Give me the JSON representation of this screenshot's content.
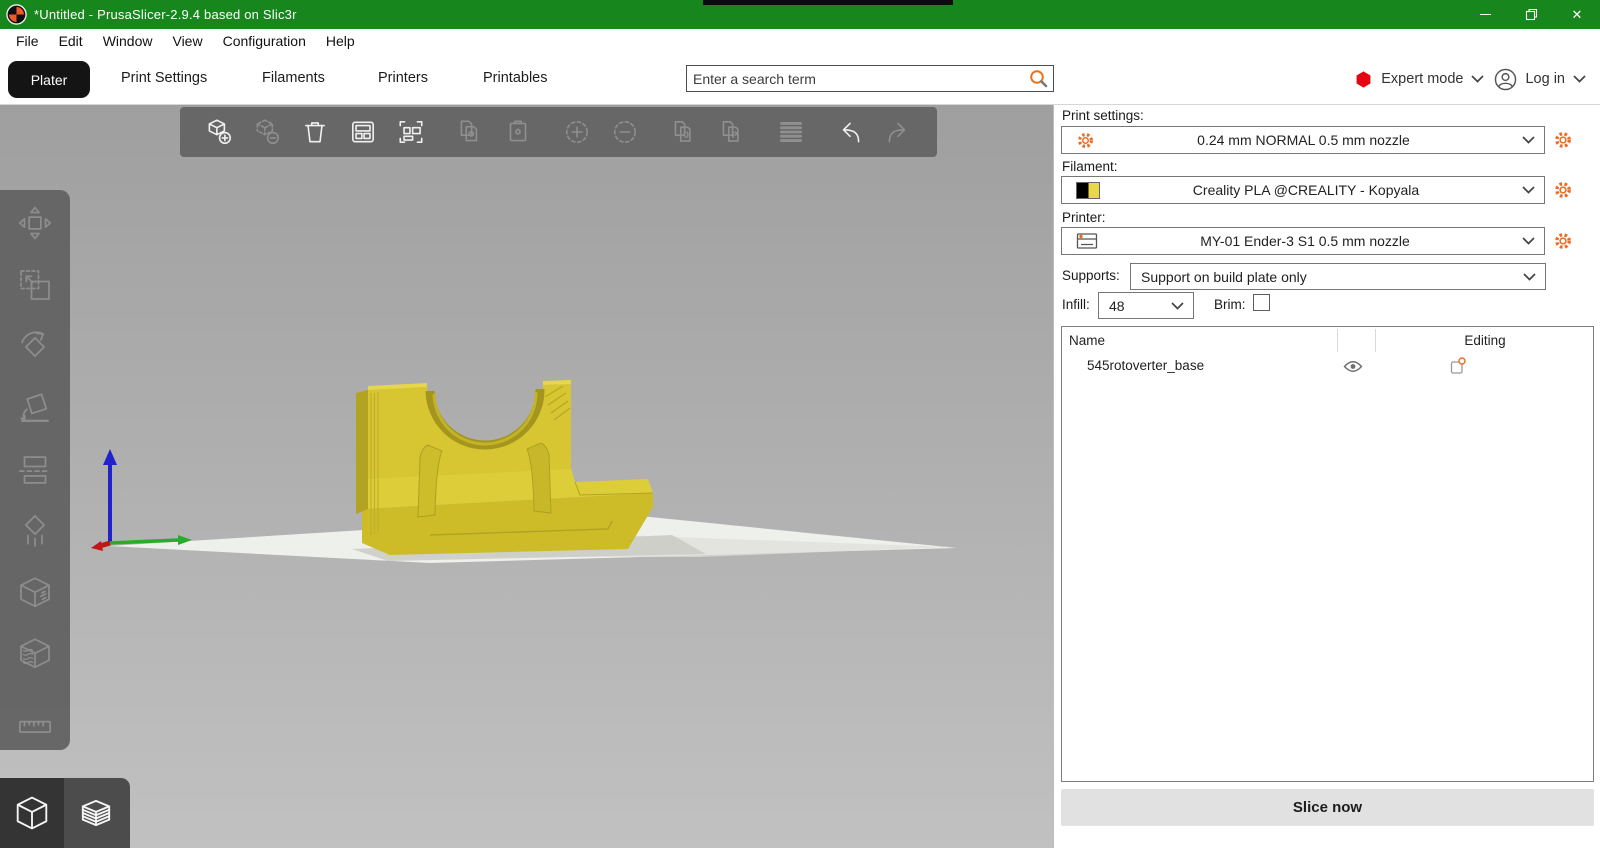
{
  "window": {
    "title": "*Untitled - PrusaSlicer-2.9.4 based on Slic3r"
  },
  "menu": {
    "items": [
      "File",
      "Edit",
      "Window",
      "View",
      "Configuration",
      "Help"
    ]
  },
  "tabs": {
    "plater": "Plater",
    "print_settings": "Print Settings",
    "filaments": "Filaments",
    "printers": "Printers",
    "printables": "Printables"
  },
  "search": {
    "placeholder": "Enter a search term"
  },
  "account": {
    "mode": "Expert mode",
    "login": "Log in"
  },
  "panel": {
    "print_settings_label": "Print settings:",
    "print_settings_value": "0.24 mm NORMAL 0.5 mm nozzle",
    "filament_label": "Filament:",
    "filament_value": "Creality PLA @CREALITY - Kopyala",
    "printer_label": "Printer:",
    "printer_value": "MY-01 Ender-3 S1 0.5 mm nozzle",
    "supports_label": "Supports:",
    "supports_value": "Support on build plate only",
    "infill_label": "Infill:",
    "infill_value": "48",
    "brim_label": "Brim:",
    "brim_checked": false,
    "list": {
      "col_name": "Name",
      "col_editing": "Editing",
      "rows": [
        {
          "name": "545rotoverter_base"
        }
      ]
    },
    "slice_button": "Slice now"
  },
  "scene": {
    "model_color": "#d7c631",
    "bed_color": "#eef0ec"
  },
  "colors": {
    "titlebar_green": "#17861d",
    "accent_orange": "#ed6b21",
    "expert_red": "#e30613",
    "plater_tab_bg": "#141414"
  }
}
